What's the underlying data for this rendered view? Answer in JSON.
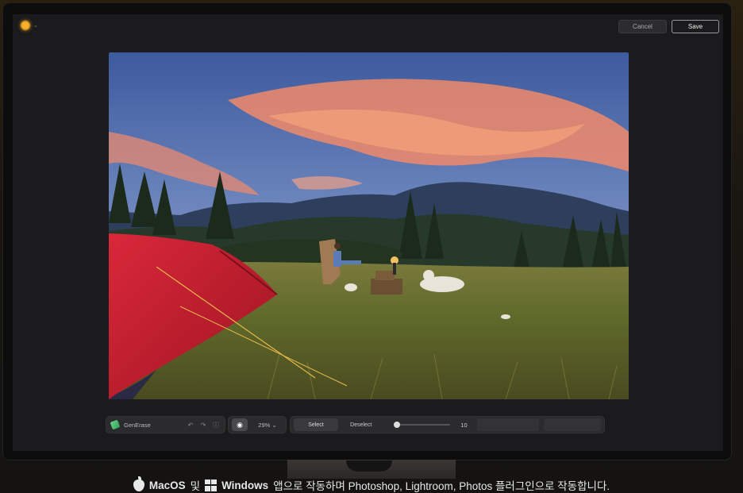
{
  "app": {
    "logo_icon": "sun-icon",
    "menu_chevron": "chevron-down-icon"
  },
  "header": {
    "cancel_label": "Cancel",
    "save_label": "Save"
  },
  "tool": {
    "name": "GenErase",
    "undo_icon": "undo-icon",
    "redo_icon": "redo-icon",
    "info_icon": "info-icon"
  },
  "view": {
    "zoom": "29%",
    "zoom_chevron": "⌄"
  },
  "selection": {
    "select_label": "Select",
    "deselect_label": "Deselect",
    "brush_size": "10",
    "brush_fraction": 0.0
  },
  "caption": {
    "mac": "MacOS",
    "and": "및",
    "windows": "Windows",
    "rest": "앱으로 작동하며 Photoshop, Lightroom, Photos 플러그인으로 작동합니다."
  },
  "colors": {
    "accent": "#f5b22c",
    "generase": "#3fb86a",
    "tent": "#c81f2e"
  }
}
